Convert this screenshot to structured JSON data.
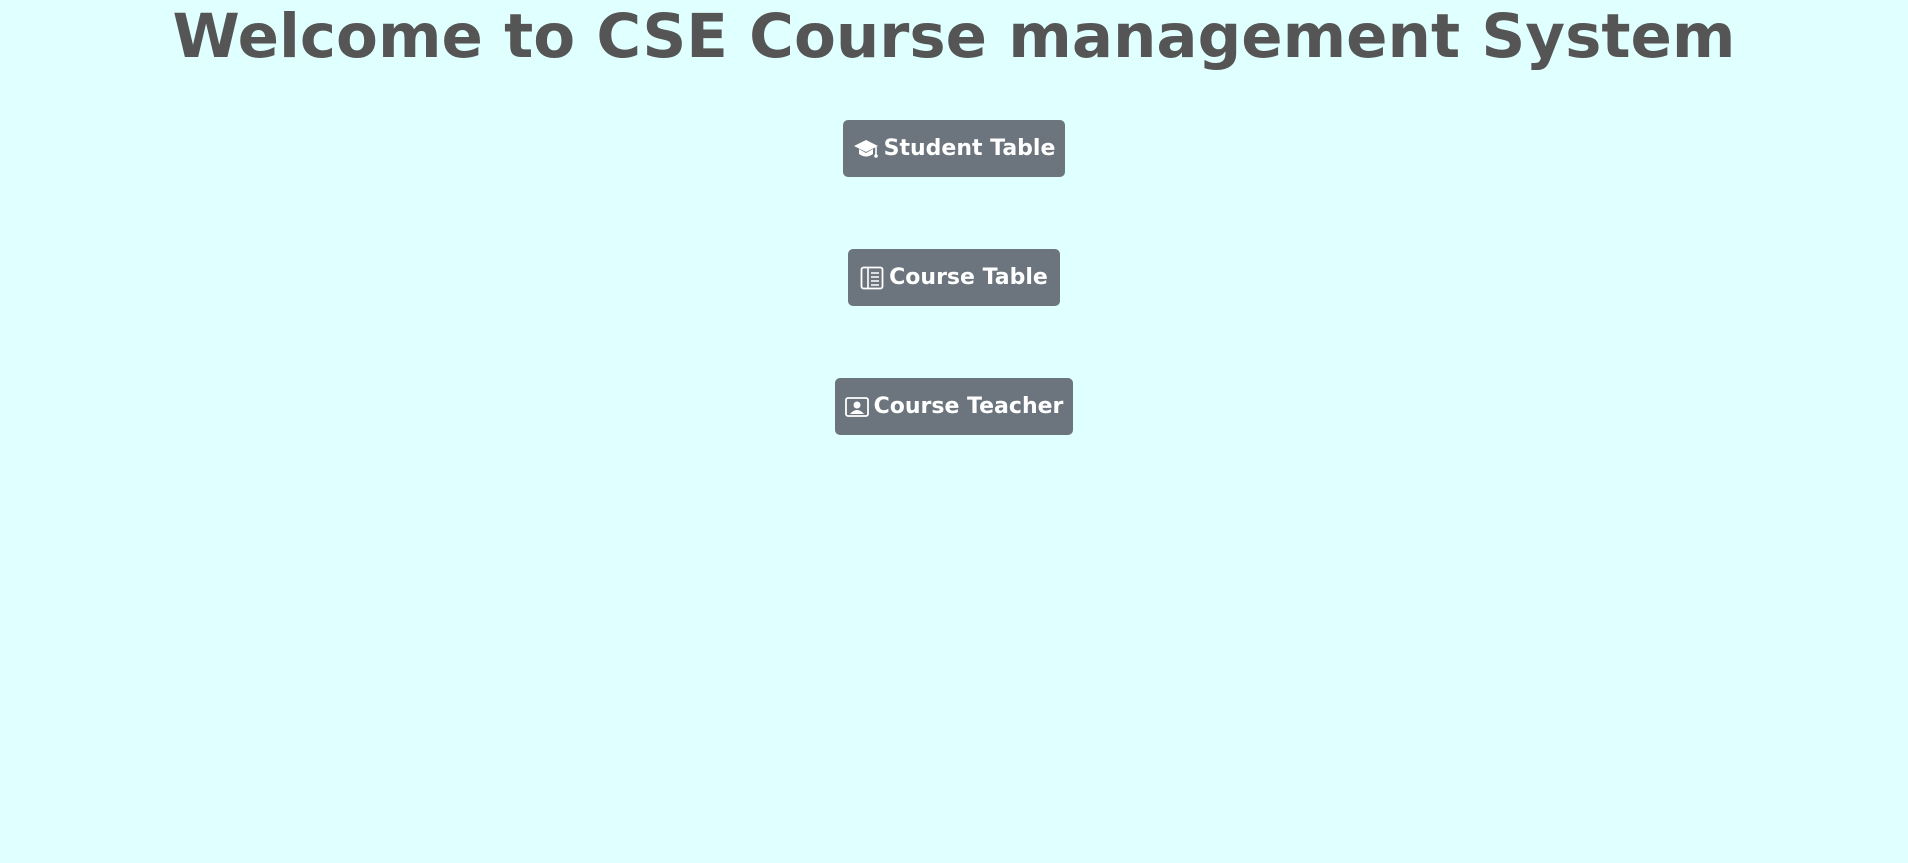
{
  "page": {
    "title": "Welcome to CSE Course management System",
    "background_color": "#e0ffff",
    "title_color": "#555555"
  },
  "buttons": [
    {
      "label": "Student Table",
      "icon": "graduation-cap-icon"
    },
    {
      "label": "Course Table",
      "icon": "book-table-icon"
    },
    {
      "label": "Course Teacher",
      "icon": "person-badge-icon"
    }
  ],
  "colors": {
    "button_bg": "#6c757d",
    "button_text": "#ffffff"
  }
}
